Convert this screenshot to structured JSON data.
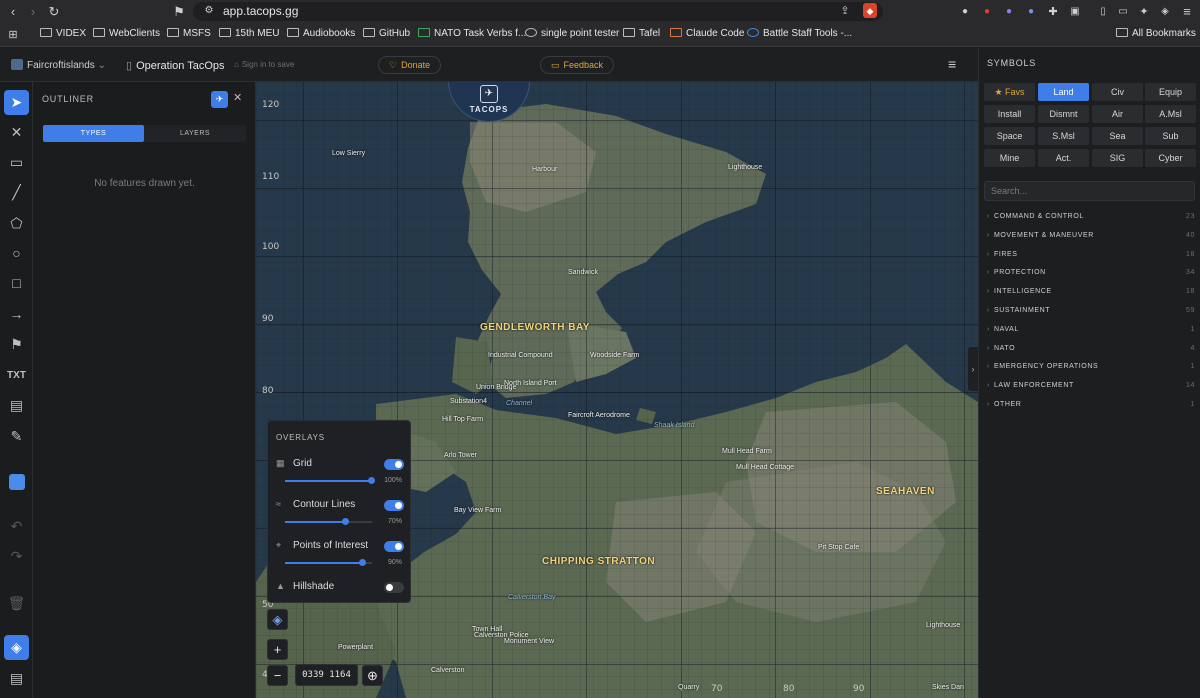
{
  "browser": {
    "url": "app.tacops.gg",
    "bookmarks": [
      "VIDEX",
      "WebClients",
      "MSFS",
      "15th MEU",
      "Audiobooks",
      "GitHub",
      "NATO Task Verbs f...",
      "single point tester",
      "Tafel",
      "Claude Code",
      "Battle Staff Tools -..."
    ],
    "all_bookmarks": "All Bookmarks"
  },
  "app": {
    "map_name": "Faircroftislands",
    "doc_title": "Operation TacOps",
    "sign_in": "Sign in to save",
    "donate": "Donate",
    "feedback": "Feedback",
    "logo": "TACOPS"
  },
  "outliner": {
    "title": "OUTLINER",
    "tabs": [
      "TYPES",
      "LAYERS"
    ],
    "empty": "No features drawn yet."
  },
  "tools": [
    "select",
    "delete",
    "comment",
    "line",
    "polygon",
    "circle",
    "rectangle",
    "arrow",
    "flag",
    "text",
    "ruler",
    "pencil",
    "color",
    "undo",
    "redo",
    "trash",
    "layers",
    "document"
  ],
  "tool_text_label": "TXT",
  "map": {
    "y_labels": [
      "120",
      "110",
      "100",
      "90",
      "80",
      "50",
      "40"
    ],
    "x_labels": [
      "70",
      "80",
      "90"
    ],
    "coords": "0339 1164",
    "places": [
      {
        "name": "Low Sierry",
        "kind": "small"
      },
      {
        "name": "Lighthouse",
        "kind": "small"
      },
      {
        "name": "Sandwick",
        "kind": "small"
      },
      {
        "name": "Harbour",
        "kind": "small"
      },
      {
        "name": "GENDLEWORTH BAY",
        "kind": "big"
      },
      {
        "name": "Industrial Compound",
        "kind": "small"
      },
      {
        "name": "Woodside Farm",
        "kind": "small"
      },
      {
        "name": "Union Bridge",
        "kind": "small"
      },
      {
        "name": "North Island Port",
        "kind": "small"
      },
      {
        "name": "Substation4",
        "kind": "small"
      },
      {
        "name": "Channel",
        "kind": "water"
      },
      {
        "name": "Faircroft Aerodrome",
        "kind": "small"
      },
      {
        "name": "Shaak Island",
        "kind": "water"
      },
      {
        "name": "Hill Top Farm",
        "kind": "small"
      },
      {
        "name": "Arlo Tower",
        "kind": "small"
      },
      {
        "name": "Mull Head Farm",
        "kind": "small"
      },
      {
        "name": "Mull Head Cottage",
        "kind": "small"
      },
      {
        "name": "Bay View Farm",
        "kind": "small"
      },
      {
        "name": "SEAHAVEN",
        "kind": "big"
      },
      {
        "name": "CHIPPING STRATTON",
        "kind": "big"
      },
      {
        "name": "Pit Stop Cafe",
        "kind": "small"
      },
      {
        "name": "Calverston Bay",
        "kind": "water"
      },
      {
        "name": "Town Hall",
        "kind": "small"
      },
      {
        "name": "Calverston Police",
        "kind": "small"
      },
      {
        "name": "Monument View",
        "kind": "small"
      },
      {
        "name": "Powerplant",
        "kind": "small"
      },
      {
        "name": "Calverston",
        "kind": "small"
      },
      {
        "name": "Lighthouse",
        "kind": "small"
      },
      {
        "name": "Quarry",
        "kind": "small"
      },
      {
        "name": "Skies Dan",
        "kind": "small"
      }
    ]
  },
  "overlays": {
    "title": "OVERLAYS",
    "items": [
      {
        "label": "Grid",
        "on": true,
        "opacity": "100%",
        "level": 1.0
      },
      {
        "label": "Contour Lines",
        "on": true,
        "opacity": "70%",
        "level": 0.7
      },
      {
        "label": "Points of Interest",
        "on": true,
        "opacity": "90%",
        "level": 0.9
      },
      {
        "label": "Hillshade",
        "on": false
      }
    ]
  },
  "symbols": {
    "title": "SYMBOLS",
    "buttons": [
      "Favs",
      "Land",
      "Civ",
      "Equip",
      "Install",
      "Dismnt",
      "Air",
      "A.Msl",
      "Space",
      "S.Msl",
      "Sea",
      "Sub",
      "Mine",
      "Act.",
      "SIG",
      "Cyber"
    ],
    "active": "Land",
    "search_placeholder": "Search...",
    "categories": [
      {
        "name": "COMMAND & CONTROL",
        "count": "23"
      },
      {
        "name": "MOVEMENT & MANEUVER",
        "count": "40"
      },
      {
        "name": "FIRES",
        "count": "18"
      },
      {
        "name": "PROTECTION",
        "count": "34"
      },
      {
        "name": "INTELLIGENCE",
        "count": "18"
      },
      {
        "name": "SUSTAINMENT",
        "count": "59"
      },
      {
        "name": "NAVAL",
        "count": "1"
      },
      {
        "name": "NATO",
        "count": "4"
      },
      {
        "name": "EMERGENCY OPERATIONS",
        "count": "1"
      },
      {
        "name": "LAW ENFORCEMENT",
        "count": "14"
      },
      {
        "name": "OTHER",
        "count": "1"
      }
    ]
  },
  "colors": {
    "accent": "#3f7ee8",
    "donate": "#e0a53a",
    "water": "#243848",
    "land": "#5d6d55"
  }
}
